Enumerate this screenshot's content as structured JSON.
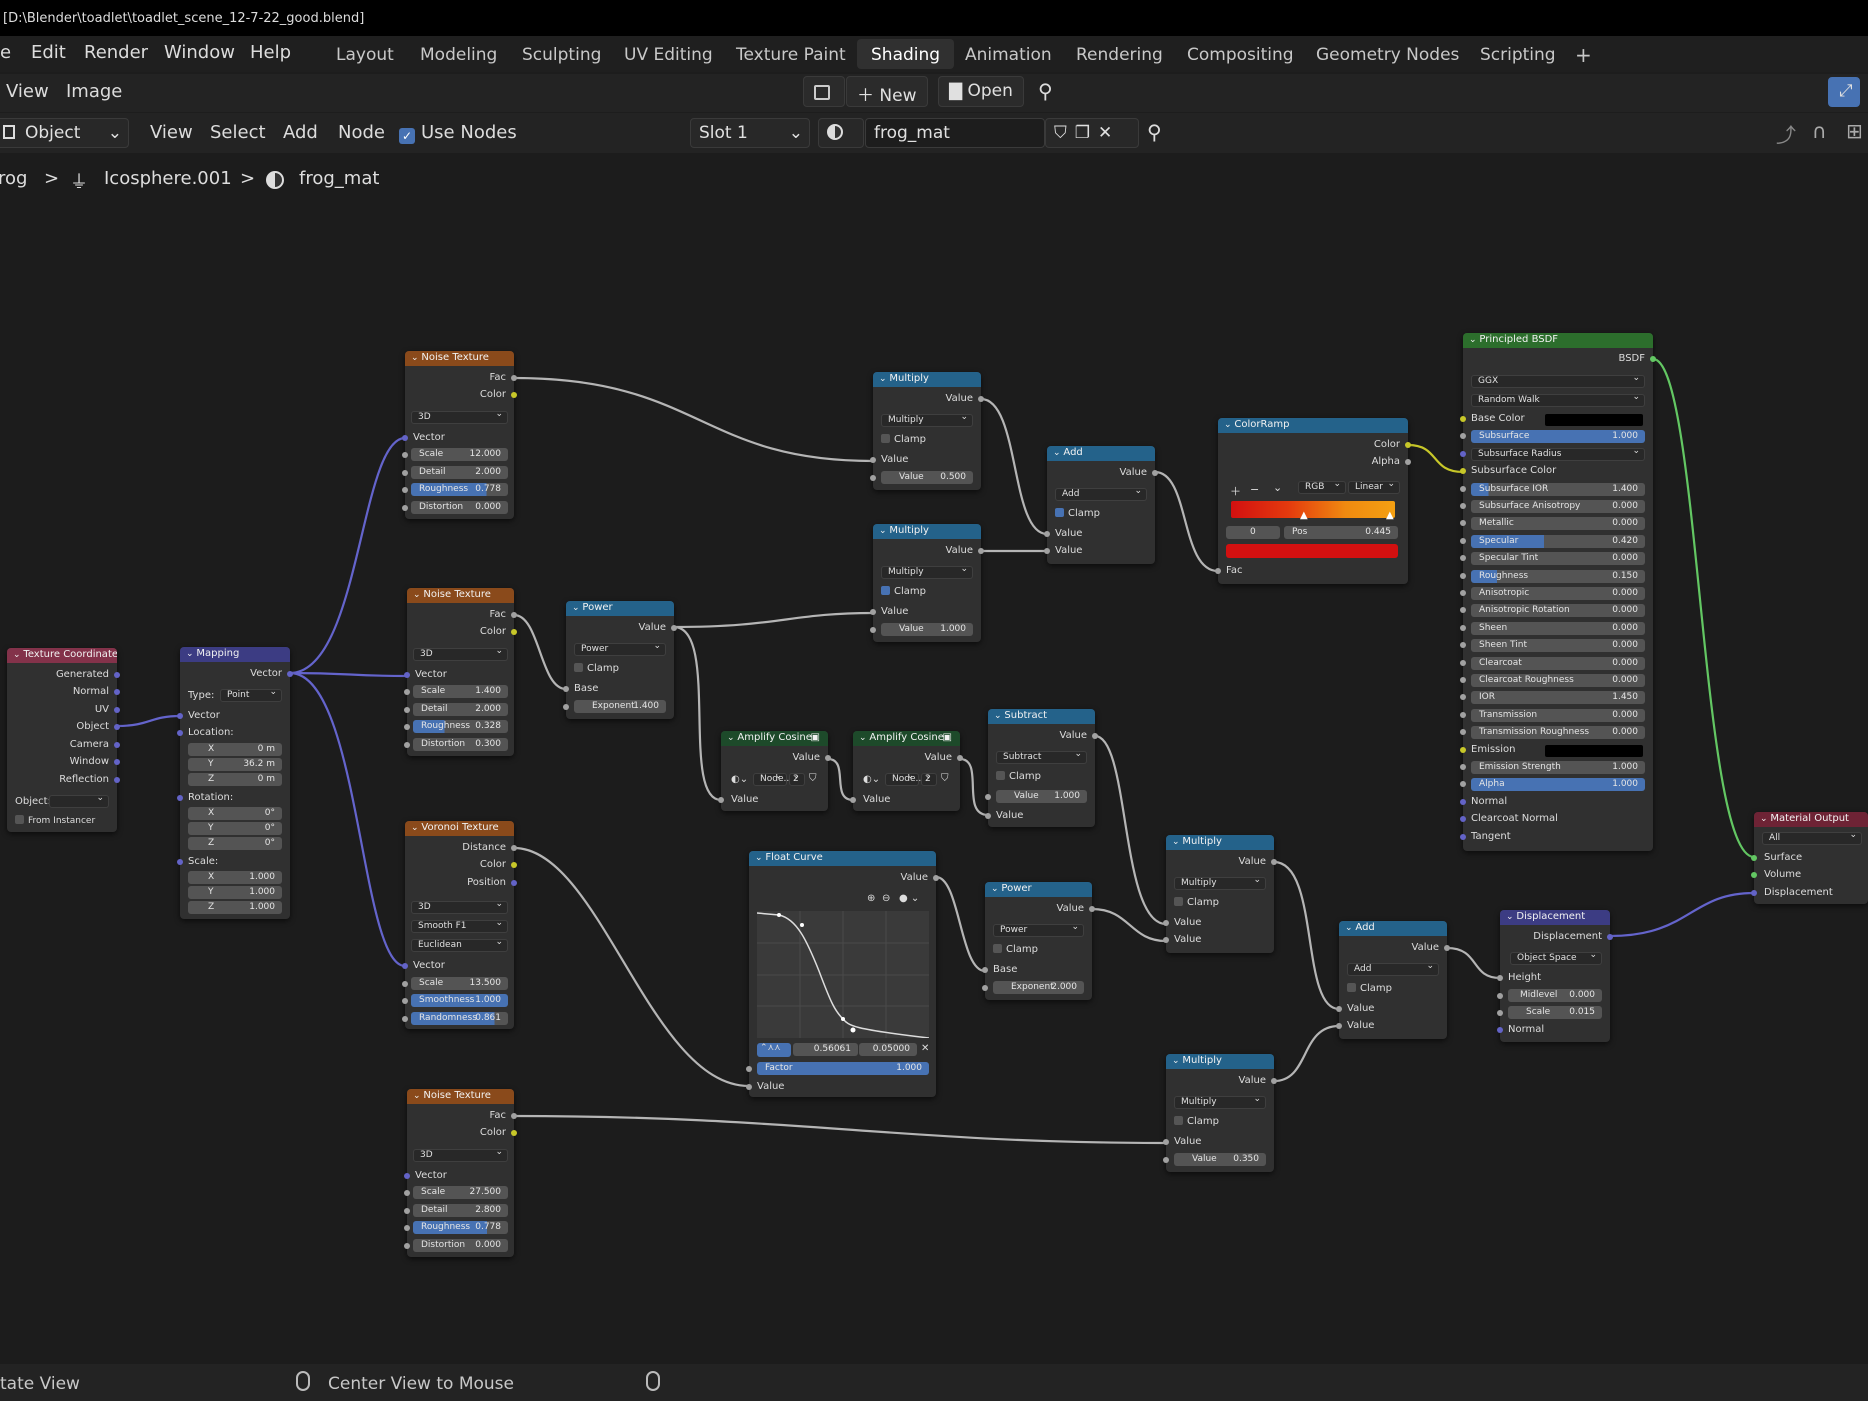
{
  "title_bar": "[D:\\Blender\\toadlet\\toadlet_scene_12-7-22_good.blend]",
  "menu": [
    "e",
    "Edit",
    "Render",
    "Window",
    "Help"
  ],
  "workspaces": [
    "Layout",
    "Modeling",
    "Sculpting",
    "UV Editing",
    "Texture Paint",
    "Shading",
    "Animation",
    "Rendering",
    "Compositing",
    "Geometry Nodes",
    "Scripting"
  ],
  "add_workspace": "+",
  "image_header": {
    "view": "View",
    "image": "Image",
    "new": "New",
    "open": "Open"
  },
  "node_header": {
    "mode": "Object",
    "view": "View",
    "select": "Select",
    "add": "Add",
    "node": "Node",
    "use_nodes": "Use Nodes",
    "slot": "Slot 1",
    "material": "frog_mat"
  },
  "breadcrumb": {
    "object": "rog",
    "mesh": "Icosphere.001",
    "material": "frog_mat",
    "sep": ">"
  },
  "status": {
    "left": "tate View",
    "center": "Center View to Mouse"
  },
  "nodes": {
    "noise1": {
      "title": "Noise Texture",
      "fac": "Fac",
      "color": "Color",
      "dim": "3D",
      "vector": "Vector",
      "scale": "Scale",
      "scale_v": "12.000",
      "detail": "Detail",
      "detail_v": "2.000",
      "rough": "Roughness",
      "rough_v": "0.778",
      "dist": "Distortion",
      "dist_v": "0.000"
    },
    "noise2": {
      "title": "Noise Texture",
      "fac": "Fac",
      "color": "Color",
      "dim": "3D",
      "vector": "Vector",
      "scale": "Scale",
      "scale_v": "1.400",
      "detail": "Detail",
      "detail_v": "2.000",
      "rough": "Roughness",
      "rough_v": "0.328",
      "dist": "Distortion",
      "dist_v": "0.300"
    },
    "noise3": {
      "title": "Noise Texture",
      "fac": "Fac",
      "color": "Color",
      "dim": "3D",
      "vector": "Vector",
      "scale": "Scale",
      "scale_v": "27.500",
      "detail": "Detail",
      "detail_v": "2.800",
      "rough": "Roughness",
      "rough_v": "0.778",
      "dist": "Distortion",
      "dist_v": "0.000"
    },
    "voronoi": {
      "title": "Voronoi Texture",
      "distance": "Distance",
      "color": "Color",
      "position": "Position",
      "dim": "3D",
      "feature": "Smooth F1",
      "metric": "Euclidean",
      "vector": "Vector",
      "scale": "Scale",
      "scale_v": "13.500",
      "smooth": "Smoothness",
      "smooth_v": "1.000",
      "rand": "Randomness",
      "rand_v": "0.861"
    },
    "texcoord": {
      "title": "Texture Coordinate",
      "outs": [
        "Generated",
        "Normal",
        "UV",
        "Object",
        "Camera",
        "Window",
        "Reflection"
      ],
      "object": "Object:",
      "instancer": "From Instancer"
    },
    "mapping": {
      "title": "Mapping",
      "vector_out": "Vector",
      "type": "Type:",
      "type_v": "Point",
      "vector": "Vector",
      "location": "Location:",
      "loc": [
        [
          "X",
          "0 m"
        ],
        [
          "Y",
          "36.2 m"
        ],
        [
          "Z",
          "0 m"
        ]
      ],
      "rotation": "Rotation:",
      "rot": [
        [
          "X",
          "0°"
        ],
        [
          "Y",
          "0°"
        ],
        [
          "Z",
          "0°"
        ]
      ],
      "scale": "Scale:",
      "scl": [
        [
          "X",
          "1.000"
        ],
        [
          "Y",
          "1.000"
        ],
        [
          "Z",
          "1.000"
        ]
      ]
    },
    "power1": {
      "title": "Power",
      "value": "Value",
      "op": "Power",
      "clamp": "Clamp",
      "base": "Base",
      "exp": "Exponent",
      "exp_v": "1.400"
    },
    "power2": {
      "title": "Power",
      "value": "Value",
      "op": "Power",
      "clamp": "Clamp",
      "base": "Base",
      "exp": "Exponent",
      "exp_v": "2.000"
    },
    "mult1": {
      "title": "Multiply",
      "value": "Value",
      "op": "Multiply",
      "clamp": "Clamp",
      "in": "Value",
      "fld": "Value",
      "fld_v": "0.500"
    },
    "mult2": {
      "title": "Multiply",
      "value": "Value",
      "op": "Multiply",
      "clamp": "Clamp",
      "in": "Value",
      "fld": "Value",
      "fld_v": "1.000"
    },
    "mult3": {
      "title": "Multiply",
      "value": "Value",
      "op": "Multiply",
      "clamp": "Clamp",
      "in1": "Value",
      "in2": "Value"
    },
    "mult4": {
      "title": "Multiply",
      "value": "Value",
      "op": "Multiply",
      "clamp": "Clamp",
      "in": "Value",
      "fld": "Value",
      "fld_v": "0.350"
    },
    "add1": {
      "title": "Add",
      "value": "Value",
      "op": "Add",
      "clamp": "Clamp",
      "in1": "Value",
      "in2": "Value"
    },
    "add2": {
      "title": "Add",
      "value": "Value",
      "op": "Add",
      "clamp": "Clamp",
      "in1": "Value",
      "in2": "Value"
    },
    "subtract": {
      "title": "Subtract",
      "value": "Value",
      "op": "Subtract",
      "clamp": "Clamp",
      "fld": "Value",
      "fld_v": "1.000",
      "in": "Value"
    },
    "amp1": {
      "title": "Amplify Cosine",
      "value": "Value",
      "grp": "Node...",
      "users": "2",
      "in": "Value"
    },
    "amp2": {
      "title": "Amplify Cosine",
      "value": "Value",
      "grp": "Node...",
      "users": "2",
      "in": "Value"
    },
    "ramp": {
      "title": "ColorRamp",
      "color": "Color",
      "alpha": "Alpha",
      "mode": "RGB",
      "interp": "Linear",
      "idx": "0",
      "pos": "Pos",
      "pos_v": "0.445",
      "fac": "Fac",
      "stop_color": "#d31010"
    },
    "curve": {
      "title": "Float Curve",
      "value": "Value",
      "px": "0.56061",
      "py": "0.05000",
      "factor": "Factor",
      "factor_v": "1.000",
      "in": "Value"
    },
    "bsdf": {
      "title": "Principled BSDF",
      "bsdf": "BSDF",
      "dist": "GGX",
      "sss": "Random Walk",
      "rows": [
        [
          "Base Color",
          "",
          false
        ],
        [
          "Subsurface",
          "1.000",
          true
        ],
        [
          "Subsurface Radius",
          "",
          false
        ],
        [
          "Subsurface Color",
          "",
          false
        ],
        [
          "Subsurface IOR",
          "1.400",
          false
        ],
        [
          "Subsurface Anisotropy",
          "0.000",
          false
        ],
        [
          "Metallic",
          "0.000",
          false
        ],
        [
          "Specular",
          "0.420",
          true
        ],
        [
          "Specular Tint",
          "0.000",
          false
        ],
        [
          "Roughness",
          "0.150",
          false
        ],
        [
          "Anisotropic",
          "0.000",
          false
        ],
        [
          "Anisotropic Rotation",
          "0.000",
          false
        ],
        [
          "Sheen",
          "0.000",
          false
        ],
        [
          "Sheen Tint",
          "0.000",
          false
        ],
        [
          "Clearcoat",
          "0.000",
          false
        ],
        [
          "Clearcoat Roughness",
          "0.000",
          false
        ],
        [
          "IOR",
          "1.450",
          false
        ],
        [
          "Transmission",
          "0.000",
          false
        ],
        [
          "Transmission Roughness",
          "0.000",
          false
        ],
        [
          "Emission",
          "",
          false
        ],
        [
          "Emission Strength",
          "1.000",
          false
        ],
        [
          "Alpha",
          "1.000",
          true
        ],
        [
          "Normal",
          "",
          false
        ],
        [
          "Clearcoat Normal",
          "",
          false
        ],
        [
          "Tangent",
          "",
          false
        ]
      ]
    },
    "disp": {
      "title": "Displacement",
      "out": "Displacement",
      "space": "Object Space",
      "height": "Height",
      "mid": "Midlevel",
      "mid_v": "0.000",
      "scale": "Scale",
      "scale_v": "0.015",
      "normal": "Normal"
    },
    "matout": {
      "title": "Material Output",
      "target": "All",
      "surface": "Surface",
      "volume": "Volume",
      "displacement": "Displacement"
    }
  }
}
